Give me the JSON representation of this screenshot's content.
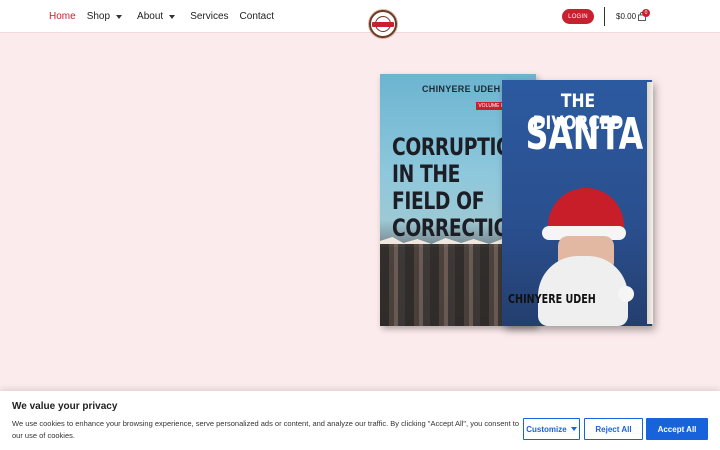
{
  "nav": {
    "items": [
      {
        "label": "Home",
        "active": true,
        "dropdown": false
      },
      {
        "label": "Shop",
        "active": false,
        "dropdown": true
      },
      {
        "label": "About",
        "active": false,
        "dropdown": true
      },
      {
        "label": "Services",
        "active": false,
        "dropdown": false
      },
      {
        "label": "Contact",
        "active": false,
        "dropdown": false
      }
    ]
  },
  "header": {
    "login_label": "LOGIN",
    "cart_total": "$0.00",
    "cart_count": "0",
    "accent_color": "#c8202e"
  },
  "books": {
    "book1": {
      "author": "CHINYERE UDEH",
      "volume": "VOLUME II",
      "title": "CORRUPTION IN THE FIELD OF CORRECTIONS"
    },
    "book2": {
      "title_line1": "THE DIVORCED",
      "title_line2": "SANTA",
      "author": "CHINYERE UDEH"
    }
  },
  "cookie": {
    "title": "We value your privacy",
    "text": "We use cookies to enhance your browsing experience, serve personalized ads or content, and analyze our traffic. By clicking \"Accept All\", you consent to our use of cookies.",
    "customize_label": "Customize",
    "reject_label": "Reject All",
    "accept_label": "Accept All",
    "button_color": "#1863dc"
  },
  "icons": {
    "cart": "shopping-bag-icon",
    "logo": "site-logo-icon"
  }
}
